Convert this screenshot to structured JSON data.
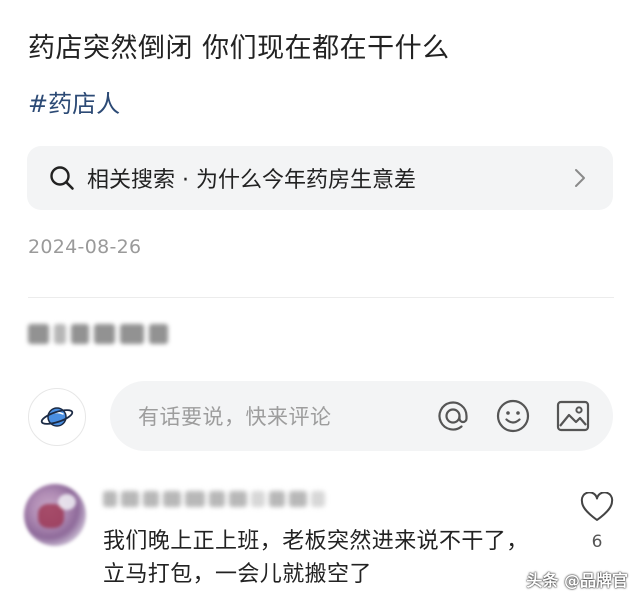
{
  "article": {
    "title": "药店突然倒闭 你们现在都在干什么",
    "hashtag": "#药店人",
    "related_search": "相关搜索 · 为什么今年药房生意差",
    "date": "2024-08-26"
  },
  "comment_box": {
    "placeholder": "有话要说，快来评论"
  },
  "comments": [
    {
      "text": "我们晚上正上班，老板突然进来说不干了，立马打包，一会儿就搬空了",
      "likes": "6"
    }
  ],
  "watermark": "头条 @品牌官",
  "colors": {
    "hashtag": "#2c4a75",
    "search_bg": "#f3f4f5",
    "meta_text": "#9a9a9a",
    "body_text": "#222222"
  },
  "icons": {
    "search": "search-icon",
    "chevron": "chevron-right-icon",
    "planet": "planet-icon",
    "at": "at-icon",
    "emoji": "emoji-icon",
    "image": "image-icon",
    "like": "heart-icon"
  }
}
